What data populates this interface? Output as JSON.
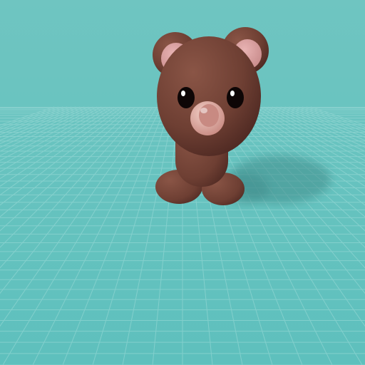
{
  "scene": {
    "subject": "bear-character",
    "colors": {
      "sky": "#6fc5c1",
      "floor": "#5ec0bd",
      "grid_line": "#9fdcd9",
      "shadow": "#3f8d8b",
      "fur_light": "#8a5546",
      "fur_mid": "#6e3f33",
      "fur_dark": "#4a2620",
      "inner_ear": "#e8b3b3",
      "inner_ear_dark": "#c48686",
      "snout": "#f1cfc6",
      "nose": "#c88a82",
      "eye": "#0e0606",
      "eye_shine": "#ffffff"
    }
  }
}
